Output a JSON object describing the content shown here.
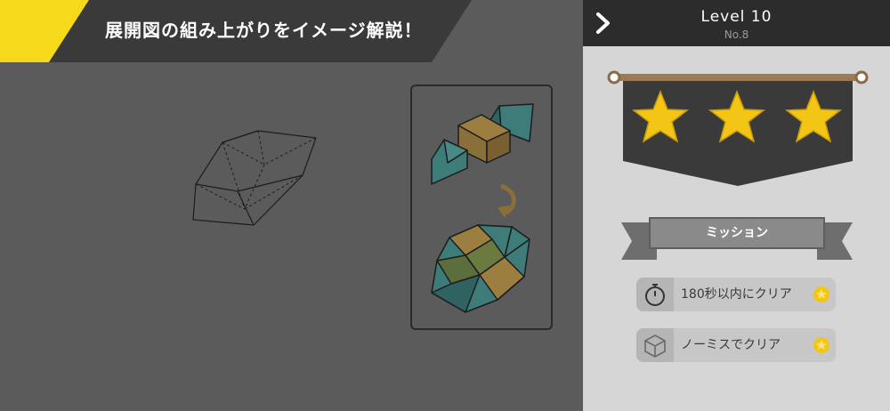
{
  "banner": {
    "text": "展開図の組み上がりをイメージ解説！"
  },
  "header": {
    "level": "Level 10",
    "stage_no": "No.8"
  },
  "rating": {
    "stars_earned": 3,
    "stars_total": 3,
    "star_color": "#f3c515"
  },
  "mission": {
    "label": "ミッション",
    "goals": [
      {
        "icon": "stopwatch-icon",
        "text": "180秒以内にクリア",
        "achieved": true
      },
      {
        "icon": "cube-icon",
        "text": "ノーミスでクリア",
        "achieved": true
      }
    ]
  },
  "colors": {
    "accent_yellow": "#f5d91a",
    "teal": "#3f7f7c",
    "brown": "#8b6f3a"
  }
}
